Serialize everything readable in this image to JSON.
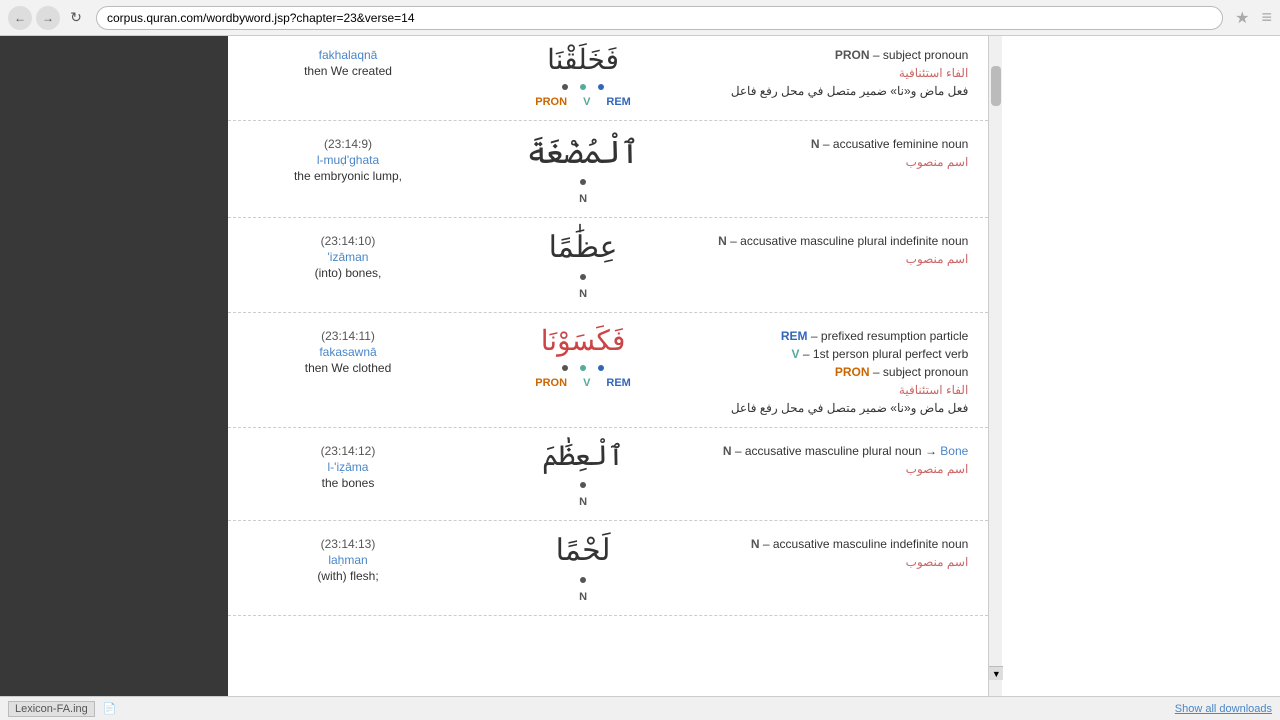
{
  "browser": {
    "url": "corpus.quran.com/wordbyword.jsp?chapter=23&verse=14",
    "back_title": "Back",
    "forward_title": "Forward",
    "refresh_title": "Refresh"
  },
  "rows": [
    {
      "id": "top-partial",
      "ref": "",
      "translit": "fakhalaqnā",
      "translation": "then We created",
      "arabic": "فَخَلَقْنَا",
      "has_pron_v_rem": true,
      "grammar_lines": [
        {
          "text": "PRON – subject pronoun",
          "type": "en"
        },
        {
          "text": "الفاء استئنافية",
          "type": "ar-red"
        },
        {
          "text": "فعل ماض و«نا» ضمير متصل في محل رفع فاعل",
          "type": "ar"
        }
      ],
      "pos_labels": [
        "PRON",
        "V",
        "REM"
      ]
    },
    {
      "id": "row-9",
      "ref": "(23:14:9)",
      "translit": "l-muḍ'ghata",
      "translation": "the embryonic lump,",
      "arabic": "ٱلْمُضْغَةَ",
      "has_n": true,
      "grammar_lines": [
        {
          "text": "N – accusative feminine noun",
          "type": "en"
        },
        {
          "text": "اسم منصوب",
          "type": "ar-red"
        }
      ],
      "pos_labels": [
        "N"
      ]
    },
    {
      "id": "row-10",
      "ref": "(23:14:10)",
      "translit": "'izāman",
      "translation": "(into) bones,",
      "arabic": "عِظَٰمًا",
      "has_n": true,
      "grammar_lines": [
        {
          "text": "N – accusative masculine plural indefinite noun",
          "type": "en"
        },
        {
          "text": "اسم منصوب",
          "type": "ar-red"
        }
      ],
      "pos_labels": [
        "N"
      ]
    },
    {
      "id": "row-11",
      "ref": "(23:14:11)",
      "translit": "fakasawnā",
      "translation": "then We clothed",
      "arabic": "فَكَسَوْنَا",
      "has_pron_v_rem": true,
      "fa_annotation": true,
      "grammar_lines": [
        {
          "text": "REM – prefixed resumption particle",
          "type": "en"
        },
        {
          "text": "V – 1st person plural perfect verb",
          "type": "en"
        },
        {
          "text": "PRON – subject pronoun",
          "type": "en"
        },
        {
          "text": "الفاء استئنافية",
          "type": "ar-red"
        },
        {
          "text": "فعل ماض و«نا» ضمير متصل في محل رفع فاعل",
          "type": "ar"
        }
      ],
      "pos_labels": [
        "PRON",
        "V",
        "REM"
      ]
    },
    {
      "id": "row-12",
      "ref": "(23:14:12)",
      "translit": "l-'iẓāma",
      "translation": "the bones",
      "arabic": "ٱلْعِظَٰمَ",
      "has_n": true,
      "grammar_lines": [
        {
          "text": "N – accusative masculine plural noun → ",
          "type": "en-link",
          "link": "Bone"
        },
        {
          "text": "اسم منصوب",
          "type": "ar-red"
        }
      ],
      "pos_labels": [
        "N"
      ]
    },
    {
      "id": "row-13",
      "ref": "(23:14:13)",
      "translit": "laḥman",
      "translation": "(with) flesh;",
      "arabic": "لَحْمًا",
      "has_n": true,
      "grammar_lines": [
        {
          "text": "N – accusative masculine indefinite noun",
          "type": "en"
        },
        {
          "text": "اسم منصوب",
          "type": "ar-red"
        }
      ],
      "pos_labels": [
        "N"
      ]
    }
  ],
  "bottom_bar": {
    "file_label": "Lexicon-FA.ing",
    "show_downloads": "Show all downloads"
  },
  "fa_label": "FA",
  "sidebar_bg": "#383838"
}
